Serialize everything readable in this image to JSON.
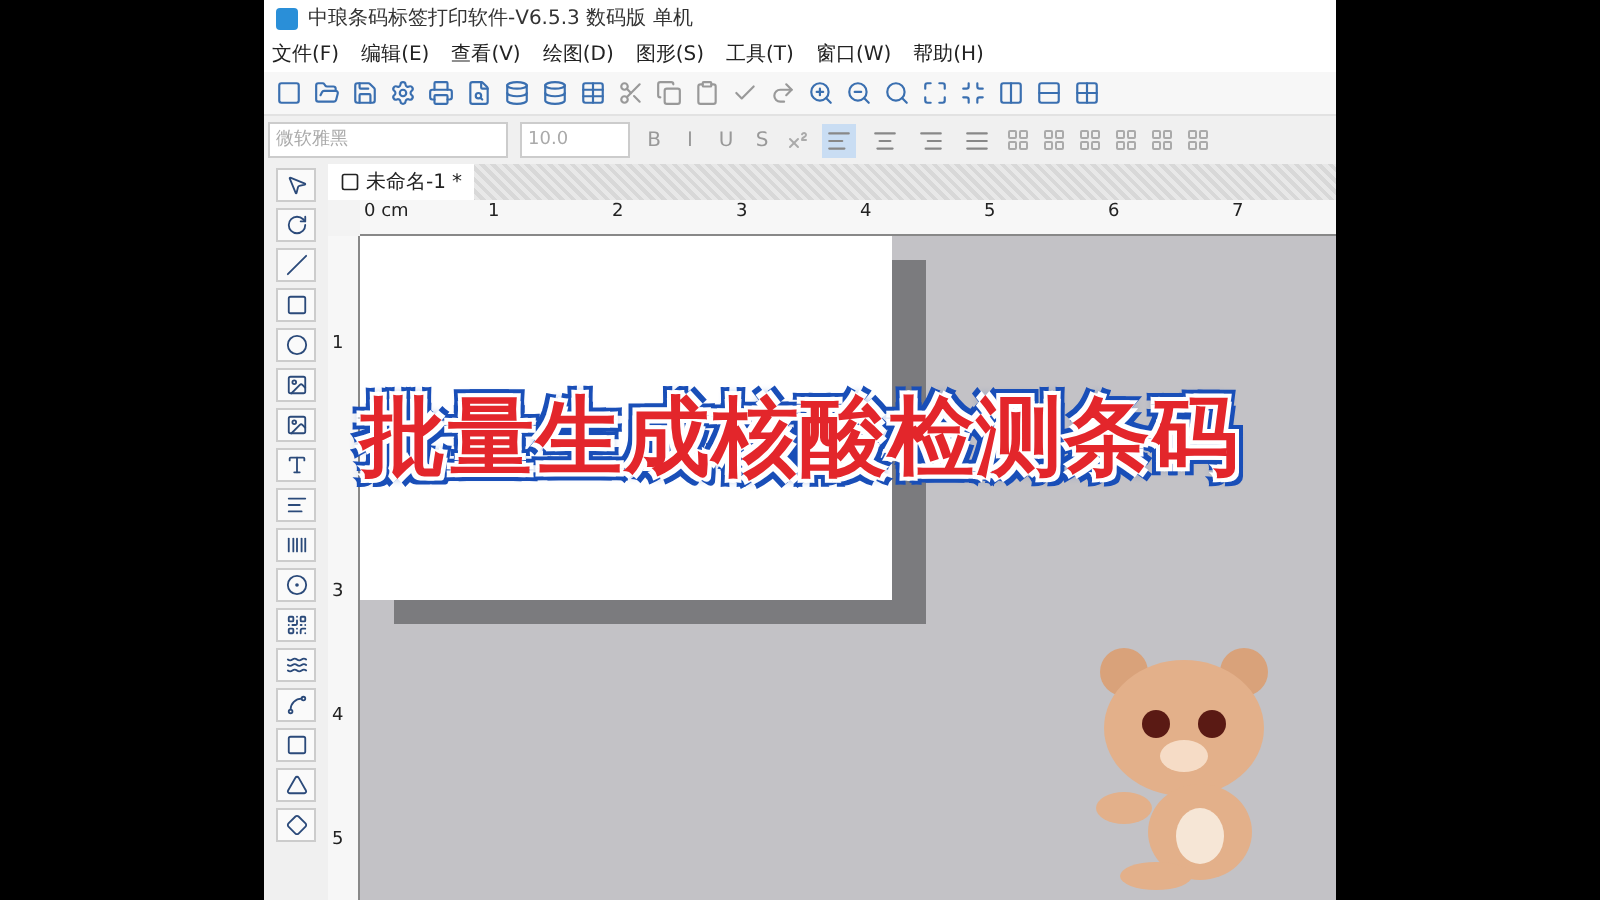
{
  "window": {
    "title": "中琅条码标签打印软件-V6.5.3 数码版 单机"
  },
  "menu": [
    "文件(F)",
    "编辑(E)",
    "查看(V)",
    "绘图(D)",
    "图形(S)",
    "工具(T)",
    "窗口(W)",
    "帮助(H)"
  ],
  "format_bar": {
    "font": {
      "placeholder": "微软雅黑"
    },
    "size": {
      "placeholder": "10.0"
    },
    "styles": [
      "B",
      "I",
      "U",
      "S"
    ],
    "align": [
      {
        "selected": true
      },
      {
        "selected": false
      },
      {
        "selected": false
      },
      {
        "selected": false
      }
    ]
  },
  "document_tab": {
    "title": "未命名-1",
    "modified_mark": "*"
  },
  "ruler": {
    "horizontal": [
      "0 cm",
      "1",
      "2",
      "3",
      "4",
      "5",
      "6",
      "7"
    ],
    "vertical": [
      "1",
      "3",
      "4",
      "5"
    ]
  },
  "caption": "批量生成核酸检测条码"
}
